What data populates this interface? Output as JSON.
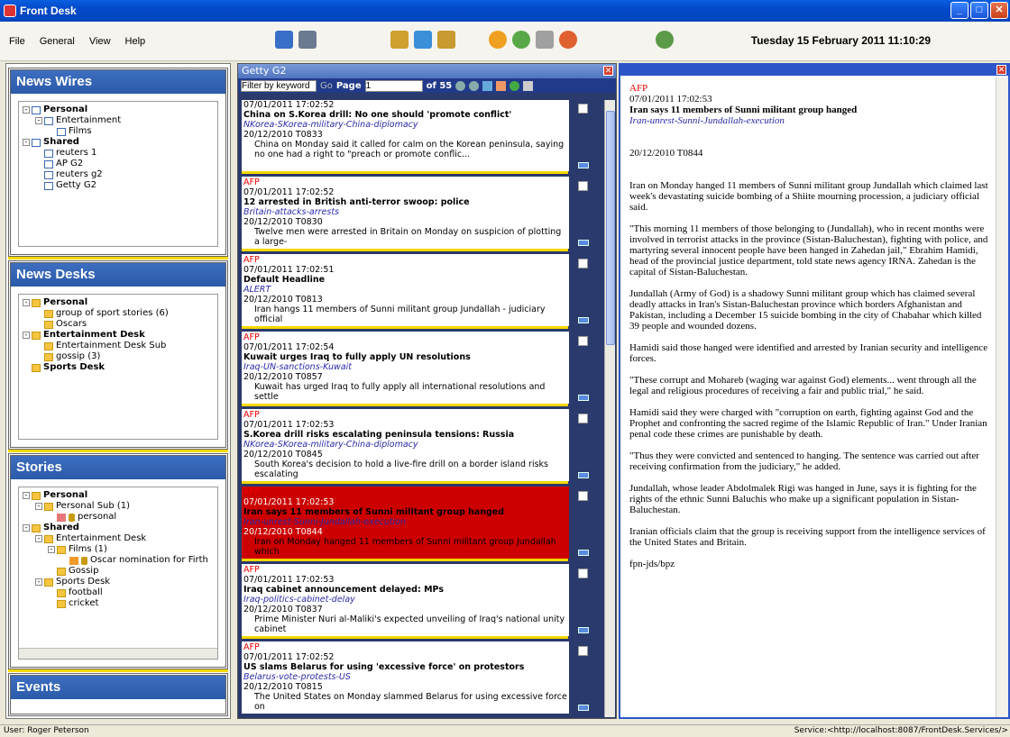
{
  "window": {
    "title": "Front Desk"
  },
  "menu": [
    "File",
    "General",
    "View",
    "Help"
  ],
  "datetime": "Tuesday 15 February 2011 11:10:29",
  "left": {
    "news_wires": {
      "title": "News Wires",
      "tree": [
        {
          "label": "Personal",
          "level": 0,
          "bold": true
        },
        {
          "label": "Entertainment",
          "level": 1
        },
        {
          "label": "Films",
          "level": 2
        },
        {
          "label": "Shared",
          "level": 0,
          "bold": true
        },
        {
          "label": "reuters 1",
          "level": 1
        },
        {
          "label": "AP G2",
          "level": 1
        },
        {
          "label": "reuters g2",
          "level": 1
        },
        {
          "label": "Getty G2",
          "level": 1
        }
      ]
    },
    "news_desks": {
      "title": "News Desks",
      "tree": [
        {
          "label": "Personal",
          "level": 0,
          "bold": true
        },
        {
          "label": "group of sport stories (6)",
          "level": 1
        },
        {
          "label": "Oscars",
          "level": 1
        },
        {
          "label": "Entertainment Desk",
          "level": 0,
          "bold": true
        },
        {
          "label": "Entertainment Desk Sub",
          "level": 1
        },
        {
          "label": "gossip (3)",
          "level": 1
        },
        {
          "label": "Sports Desk",
          "level": 0,
          "bold": true
        }
      ]
    },
    "stories": {
      "title": "Stories",
      "tree": [
        {
          "label": "Personal",
          "level": 0,
          "bold": true
        },
        {
          "label": "Personal Sub (1)",
          "level": 1
        },
        {
          "label": "personal",
          "level": 2
        },
        {
          "label": "Shared",
          "level": 0,
          "bold": true
        },
        {
          "label": "Entertainment Desk",
          "level": 1
        },
        {
          "label": "Films (1)",
          "level": 2
        },
        {
          "label": "Oscar nomination for Firth",
          "level": 3
        },
        {
          "label": "Gossip",
          "level": 2
        },
        {
          "label": "Sports Desk",
          "level": 1
        },
        {
          "label": "football",
          "level": 2
        },
        {
          "label": "cricket",
          "level": 2
        }
      ]
    },
    "events": {
      "title": "Events"
    }
  },
  "feed": {
    "title": "Getty G2",
    "filter_label": "Filter by keyword",
    "go_label": "Go",
    "page_label": "Page",
    "page_value": "1",
    "of_label": "of 55",
    "items": [
      {
        "source": "",
        "time": "07/01/2011 17:02:52",
        "headline": "China on S.Korea drill: No one should 'promote conflict'",
        "slug": "NKorea-SKorea-military-China-diplomacy",
        "ref": "20/12/2010 T0833",
        "body": "China on Monday said it called for calm on the Korean peninsula, saying no one had a right to \"preach or promote conflic..."
      },
      {
        "source": "AFP",
        "time": "07/01/2011 17:02:52",
        "headline": "12 arrested in British anti-terror swoop: police",
        "slug": "Britain-attacks-arrests",
        "ref": "20/12/2010 T0830",
        "body": "Twelve men were arrested in Britain on Monday on suspicion of plotting a large-"
      },
      {
        "source": "AFP",
        "time": "07/01/2011 17:02:51",
        "headline": "Default Headline",
        "slug": "ALERT",
        "ref": "20/12/2010 T0813",
        "body": "Iran hangs 11 members of Sunni militant group Jundallah - judiciary official"
      },
      {
        "source": "AFP",
        "time": "07/01/2011 17:02:54",
        "headline": "Kuwait urges Iraq to fully apply UN resolutions",
        "slug": "Iraq-UN-sanctions-Kuwait",
        "ref": "20/12/2010 T0857",
        "body": "Kuwait has urged Iraq to fully apply all international resolutions and settle"
      },
      {
        "source": "AFP",
        "time": "07/01/2011 17:02:53",
        "headline": "S.Korea drill risks escalating peninsula tensions: Russia",
        "slug": "NKorea-SKorea-military-China-diplomacy",
        "ref": "20/12/2010 T0845",
        "body": "South Korea's decision to hold a live-fire drill on a border island risks escalating"
      },
      {
        "source": "AFP",
        "time": "07/01/2011 17:02:53",
        "headline": "Iran says 11 members of Sunni militant group hanged",
        "slug": "Iran-unrest-Sunni-Jundallah-execution",
        "ref": "20/12/2010 T0844",
        "body": "Iran on Monday hanged 11 members of Sunni militant group Jundallah which"
      },
      {
        "source": "AFP",
        "time": "07/01/2011 17:02:53",
        "headline": "Iraq cabinet announcement delayed: MPs",
        "slug": "Iraq-politics-cabinet-delay",
        "ref": "20/12/2010 T0837",
        "body": "Prime Minister Nuri al-Maliki's expected unveiling of Iraq's national unity cabinet"
      },
      {
        "source": "AFP",
        "time": "07/01/2011 17:02:52",
        "headline": "US slams Belarus for using 'excessive force' on protestors",
        "slug": "Belarus-vote-protests-US",
        "ref": "20/12/2010 T0815",
        "body": "The United States on Monday slammed Belarus for using excessive force on"
      }
    ]
  },
  "article": {
    "source": "AFP",
    "time": "07/01/2011 17:02:53",
    "headline": "Iran says 11 members of Sunni militant group hanged",
    "slug": "Iran-unrest-Sunni-Jundallah-execution",
    "ref": "20/12/2010 T0844",
    "paragraphs": [
      "Iran on Monday hanged 11 members of Sunni militant group Jundallah which claimed last week's devastating suicide bombing of a Shiite mourning procession, a judiciary official said.",
      "\"This morning 11 members of those belonging to (Jundallah), who in recent months were involved in terrorist attacks in the province (Sistan-Baluchestan), fighting with police, and martyring several innocent people have been hanged in Zahedan jail,\" Ebrahim Hamidi, head of the provincial justice department, told state news agency IRNA. Zahedan is the capital of Sistan-Baluchestan.",
      "Jundallah (Army of God) is a shadowy Sunni militant group which has claimed several deadly attacks in Iran's Sistan-Baluchestan province which borders Afghanistan and Pakistan, including a December 15 suicide bombing in the city of Chabahar which killed 39 people and wounded dozens.",
      "Hamidi said those hanged were identified and arrested by Iranian security and intelligence forces.",
      "\"These corrupt and Mohareb (waging war against God) elements... went through all the legal and religious procedures of receiving a fair and public trial,\" he said.",
      "Hamidi said they were charged with \"corruption on earth, fighting against God and the Prophet and confronting the sacred regime of the Islamic Republic of Iran.\" Under Iranian penal code these crimes are punishable by death.",
      "\"Thus they were convicted and sentenced to hanging. The sentence was carried out after receiving confirmation from the judiciary,\" he added.",
      "Jundallah, whose leader Abdolmalek Rigi was hanged in June, says it is fighting for the rights of the ethnic Sunni Baluchis who make up a significant population in Sistan-Baluchestan.",
      "Iranian officials claim that the group is receiving support from the intelligence services of the United States and Britain.",
      "fpn-jds/bpz"
    ]
  },
  "status": {
    "user": "User: Roger Peterson",
    "service": "Service:<http://localhost:8087/FrontDesk.Services/>"
  }
}
